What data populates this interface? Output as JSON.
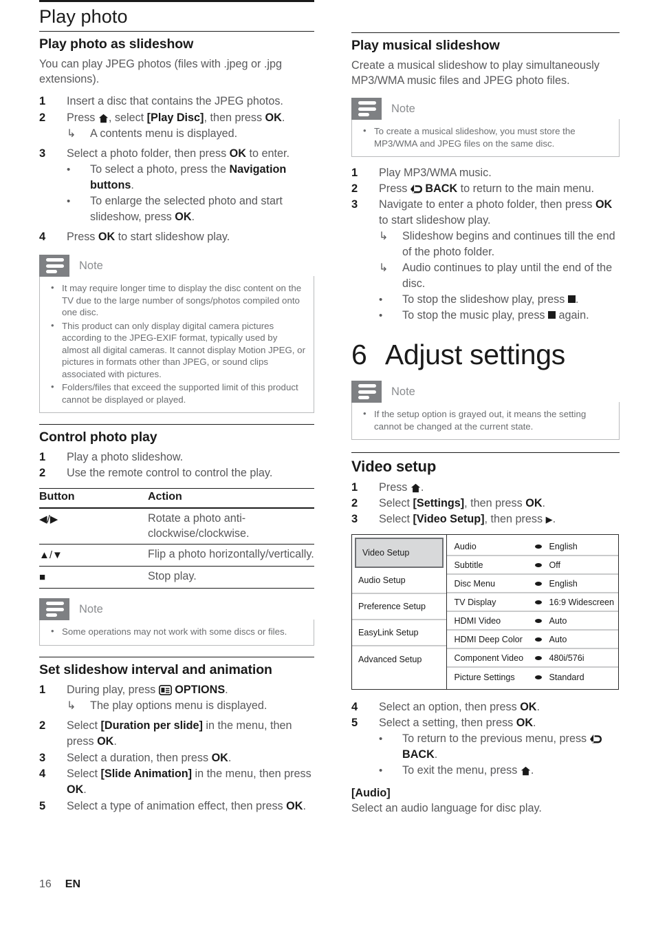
{
  "left": {
    "chapter_heading": "Play photo",
    "section1": {
      "title": "Play photo as slideshow",
      "intro": "You can play JPEG photos (files with .jpeg or .jpg extensions).",
      "steps": [
        {
          "num": "1",
          "text": "Insert a disc that contains the JPEG photos."
        },
        {
          "num": "2",
          "text": "Press ⌂, select [Play Disc], then press OK."
        },
        {
          "num": "3",
          "text": "Select a photo folder, then press OK to enter."
        },
        {
          "num": "4",
          "text": "Press OK to start slideshow play."
        }
      ],
      "step2_result": "A contents menu is displayed.",
      "step3_bullets": [
        "To select a photo, press the Navigation buttons.",
        "To enlarge the selected photo and start slideshow, press OK."
      ]
    },
    "note1": {
      "label": "Note",
      "items": [
        "It may require longer time to display the disc content on the TV due to the large number of songs/photos compiled onto one disc.",
        "This product can only display digital camera pictures according to the JPEG-EXIF format, typically used by almost all digital cameras. It cannot display Motion JPEG, or pictures in formats other than JPEG, or sound clips associated with pictures.",
        "Folders/files that exceed the supported limit of this product cannot be displayed or played."
      ]
    },
    "section2": {
      "title": "Control photo play",
      "steps": [
        {
          "num": "1",
          "text": "Play a photo slideshow."
        },
        {
          "num": "2",
          "text": "Use the remote control to control the play."
        }
      ],
      "table": {
        "headers": [
          "Button",
          "Action"
        ],
        "rows": [
          {
            "button": "◀/▶",
            "action": "Rotate a photo anti-clockwise/clockwise."
          },
          {
            "button": "▲/▼",
            "action": "Flip a photo horizontally/vertically."
          },
          {
            "button": "■",
            "action": "Stop play."
          }
        ]
      }
    },
    "note2": {
      "label": "Note",
      "items": [
        "Some operations may not work with some discs or files."
      ]
    },
    "section3": {
      "title": "Set slideshow interval and animation",
      "steps": [
        {
          "num": "1",
          "text": "During play, press ▤ OPTIONS."
        },
        {
          "num": "2",
          "text": "Select [Duration per slide] in the menu, then press OK."
        },
        {
          "num": "3",
          "text": "Select a duration, then press OK."
        },
        {
          "num": "4",
          "text": "Select [Slide Animation] in the menu, then press OK."
        },
        {
          "num": "5",
          "text": "Select a type of animation effect, then press OK."
        }
      ],
      "step1_result": "The play options menu is displayed."
    }
  },
  "right": {
    "section1": {
      "title": "Play musical slideshow",
      "intro": "Create a musical slideshow to play simultaneously MP3/WMA music files and JPEG photo files.",
      "note": {
        "label": "Note",
        "items": [
          "To create a musical slideshow, you must store the MP3/WMA and JPEG files on the same disc."
        ]
      },
      "steps": [
        {
          "num": "1",
          "text": "Play MP3/WMA music."
        },
        {
          "num": "2",
          "text": "Press ↶ BACK to return to the main menu."
        },
        {
          "num": "3",
          "text": "Navigate to enter a photo folder, then press OK to start slideshow play."
        }
      ],
      "step3_results": [
        "Slideshow begins and continues till the end of the photo folder.",
        "Audio continues to play until the end of the disc."
      ],
      "step3_bullets": [
        "To stop the slideshow play, press ■.",
        "To stop the music play, press ■ again."
      ]
    },
    "chapter": {
      "number": "6",
      "title": "Adjust settings"
    },
    "note_chapter": {
      "label": "Note",
      "items": [
        "If the setup option is grayed out, it means the setting cannot be changed at the current state."
      ]
    },
    "section2": {
      "title": "Video setup",
      "steps": [
        {
          "num": "1",
          "text": "Press ⌂."
        },
        {
          "num": "2",
          "text": "Select [Settings], then press OK."
        },
        {
          "num": "3",
          "text": "Select [Video Setup], then press ▶."
        }
      ],
      "steps_after": [
        {
          "num": "4",
          "text": "Select an option, then press OK."
        },
        {
          "num": "5",
          "text": "Select a setting, then press OK."
        }
      ],
      "after_bullets": [
        "To return to the previous menu, press ↶ BACK.",
        "To exit the menu, press ⌂."
      ],
      "definition_term": "[Audio]",
      "definition_text": "Select an audio language for disc play."
    },
    "settings_menu": {
      "categories": [
        {
          "label": "Video Setup",
          "selected": true
        },
        {
          "label": "Audio Setup",
          "selected": false
        },
        {
          "label": "Preference Setup",
          "selected": false
        },
        {
          "label": "EasyLink Setup",
          "selected": false
        },
        {
          "label": "Advanced Setup",
          "selected": false
        }
      ],
      "options": [
        {
          "label": "Audio",
          "value": "English"
        },
        {
          "label": "Subtitle",
          "value": "Off"
        },
        {
          "label": "Disc Menu",
          "value": "English"
        },
        {
          "label": "TV Display",
          "value": "16:9 Widescreen"
        },
        {
          "label": "HDMI Video",
          "value": "Auto"
        },
        {
          "label": "HDMI Deep Color",
          "value": "Auto"
        },
        {
          "label": "Component Video",
          "value": "480i/576i"
        },
        {
          "label": "Picture Settings",
          "value": "Standard"
        }
      ]
    }
  },
  "footer": {
    "page_number": "16",
    "language": "EN"
  },
  "colors": {
    "note_icon_bg": "#7e8083",
    "menu_selected_bg": "#d8d9da",
    "menu_rule": "#c9cacb",
    "body_text": "#58585a",
    "heading_text": "#1a1a1a"
  }
}
